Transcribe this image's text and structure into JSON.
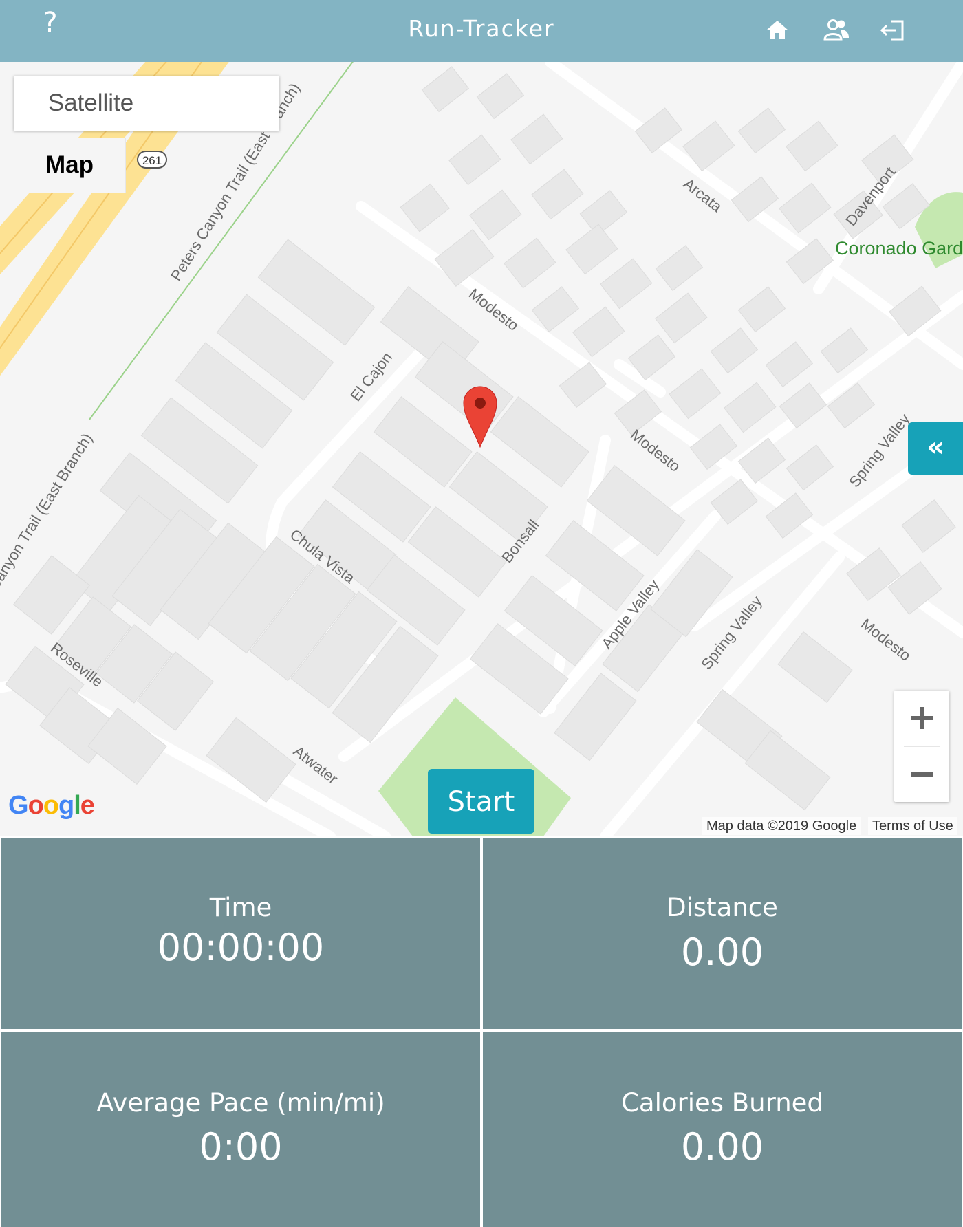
{
  "header": {
    "help_label": "?",
    "title": "Run-Tracker",
    "icons": [
      "home-icon",
      "users-icon",
      "logout-icon"
    ]
  },
  "map": {
    "type_options": {
      "map": "Map",
      "satellite": "Satellite"
    },
    "selected_type": "Map",
    "collapse_label": "«",
    "start_label": "Start",
    "zoom_in_label": "+",
    "zoom_out_label": "−",
    "google_logo": "Google",
    "attribution": "Map data ©2019 Google",
    "terms": "Terms of Use",
    "highway_shield": "261",
    "labels": {
      "trail_upper": "Peters Canyon Trail (East Branch)",
      "trail_lower": "Canyon Trail (East Branch)",
      "arcata": "Arcata",
      "davenport": "Davenport",
      "coronado": "Coronado Gard",
      "modesto_1": "Modesto",
      "modesto_2": "Modesto",
      "modesto_3": "Modesto",
      "el_cajon": "El Cajon",
      "spring_valley_1": "Spring Valley",
      "spring_valley_2": "Spring Valley",
      "chula_vista": "Chula Vista",
      "bonsall": "Bonsall",
      "apple_valley": "Apple Valley",
      "roseville": "Roseville",
      "atwater": "Atwater"
    },
    "colors": {
      "park": "#c5e8b0",
      "highway": "#fde293",
      "pin": "#ea4335",
      "accent": "#17a2b8"
    }
  },
  "stats": {
    "time": {
      "label": "Time",
      "value": "00:00:00"
    },
    "distance": {
      "label": "Distance",
      "value": "0.00"
    },
    "pace": {
      "label": "Average Pace (min/mi)",
      "value": "0:00"
    },
    "calories": {
      "label": "Calories Burned",
      "value": "0.00"
    }
  }
}
